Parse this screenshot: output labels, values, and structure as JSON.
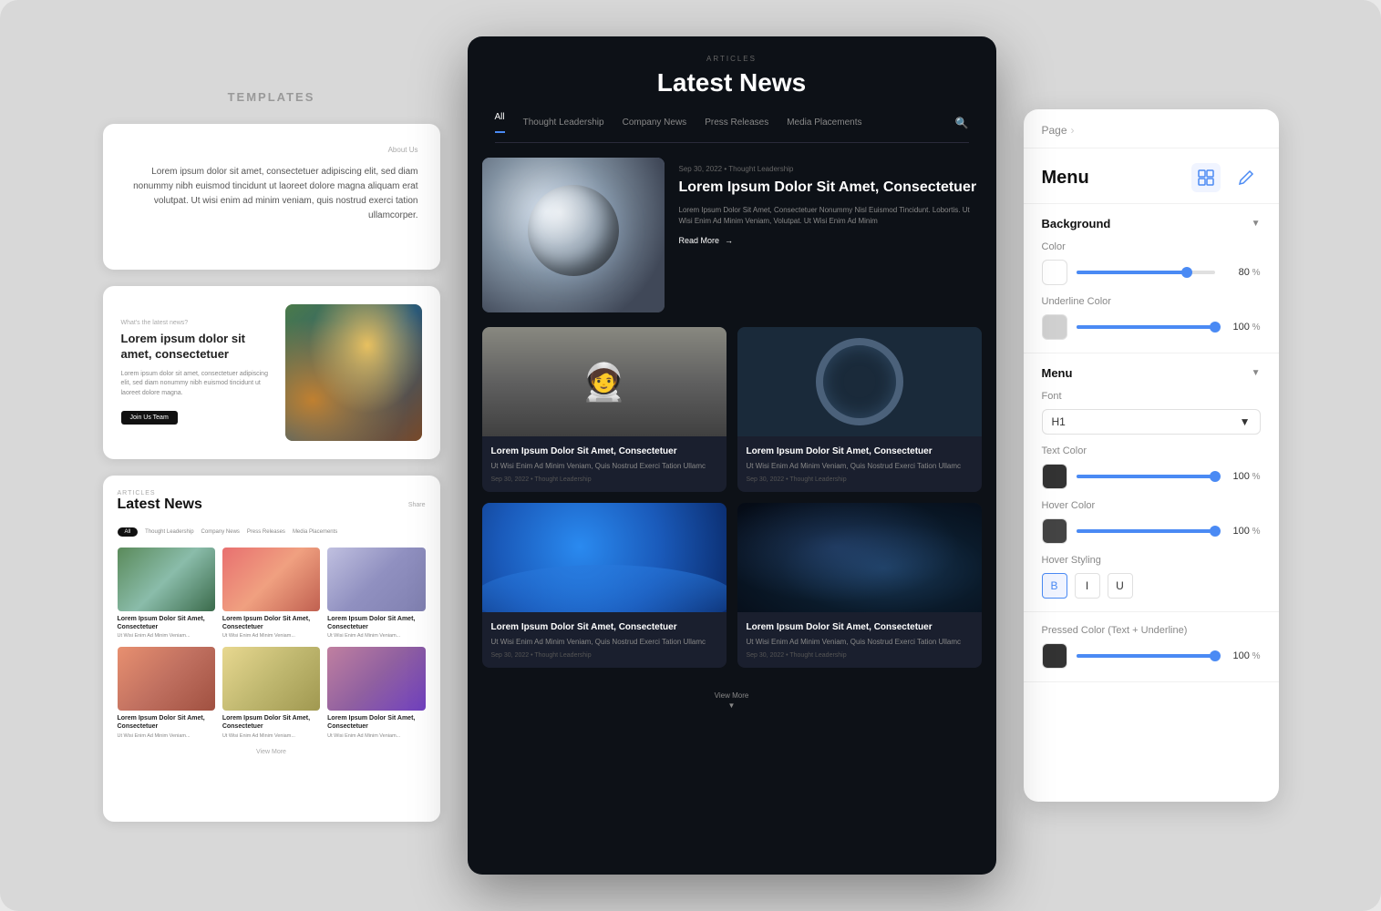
{
  "templates_label": "TEMPLATES",
  "card1": {
    "about_us": "About Us",
    "body": "Lorem ipsum dolor sit amet, consectetuer adipiscing elit, sed diam nonummy nibh euismod tincidunt ut laoreet dolore magna aliquam erat volutpat. Ut wisi enim ad minim veniam, quis nostrud exerci tation ullamcorper."
  },
  "card2": {
    "label": "What's the latest news?",
    "heading": "Lorem ipsum dolor sit amet, consectetuer",
    "body": "Lorem ipsum dolor sit amet, consectetuer adipiscing elit, sed diam nonummy nibh euismod tincidunt ut laoreet dolore magna.",
    "btn_label": "Join Us Team"
  },
  "card3": {
    "articles_label": "ARTICLES",
    "title": "Latest News",
    "share": "Share",
    "nav_items": [
      "All",
      "Thought Leadership",
      "Company News",
      "Press Releases",
      "Media Placements"
    ],
    "items": [
      {
        "title": "Lorem Ipsum Dolor Sit Amet, Consectetuer",
        "body": "Ut Wisi Enim Ad Minim Veniam, Quis Nostrud Exerci Tation Ullamc"
      },
      {
        "title": "Lorem Ipsum Dolor Sit Amet, Consectetuer",
        "body": "Ut Wisi Enim Ad Minim Veniam, Quis Nostrud Exerci Tation Ullamc"
      },
      {
        "title": "Lorem Ipsum Dolor Sit Amet, Consectetuer",
        "body": "Ut Wisi Enim Ad Minim Veniam, Quis Nostrud Exerci Tation Ullamc"
      },
      {
        "title": "Lorem Ipsum Dolor Sit Amet, Consectetuer",
        "body": "Ut Wisi Enim Ad Minim Veniam, Quis Nostrud Exerci Tation Ullamc"
      },
      {
        "title": "Lorem Ipsum Dolor Sit Amet, Consectetuer",
        "body": "Ut Wisi Enim Ad Minim Veniam, Quis Nostrud Exerci Tation Ullamc"
      },
      {
        "title": "Lorem Ipsum Dolor Sit Amet, Consectetuer",
        "body": "Ut Wisi Enim Ad Minim Veniam, Quis Nostrud Exerci Tation Ullamc"
      }
    ],
    "view_more": "View More"
  },
  "preview": {
    "articles_label": "ARTICLES",
    "title": "Latest News",
    "nav_items": [
      "All",
      "Thought Leadership",
      "Company News",
      "Press Releases",
      "Media Placements"
    ],
    "hero": {
      "meta": "Sep 30, 2022  •  Thought Leadership",
      "heading": "Lorem Ipsum Dolor Sit Amet, Consectetuer",
      "body": "Lorem Ipsum Dolor Sit Amet, Consectetuer Nonummy Nisl Euismod Tincidunt. Lobortis. Ut Wisi Enim Ad Minim Veniam, Volutpat. Ut Wisi Enim Ad Minim",
      "read_more": "Read More"
    },
    "articles": [
      {
        "title": "Lorem Ipsum Dolor Sit Amet, Consectetuer",
        "body": "Ut Wisi Enim Ad Minim Veniam, Quis Nostrud Exerci Tation Ullamc",
        "meta": "Sep 30, 2022  •  Thought Leadership"
      },
      {
        "title": "Lorem Ipsum Dolor Sit Amet, Consectetuer",
        "body": "Ut Wisi Enim Ad Minim Veniam, Quis Nostrud Exerci Tation Ullamc",
        "meta": "Sep 30, 2022  •  Thought Leadership"
      },
      {
        "title": "Lorem Ipsum Dolor Sit Amet, Consectetuer",
        "body": "Ut Wisi Enim Ad Minim Veniam, Quis Nostrud Exerci Tation Ullamc",
        "meta": "Sep 30, 2022  •  Thought Leadership"
      },
      {
        "title": "Lorem Ipsum Dolor Sit Amet, Consectetuer",
        "body": "Ut Wisi Enim Ad Minim Veniam, Quis Nostrud Exerci Tation Ullamc",
        "meta": "Sep 30, 2022  •  Thought Leadership"
      }
    ],
    "view_more": "View More"
  },
  "panel": {
    "breadcrumb": "Page",
    "title": "Menu",
    "sections": {
      "background": {
        "label": "Background",
        "color_label": "Color",
        "color_value": "80",
        "underline_color_label": "Underline Color",
        "underline_value": "100"
      },
      "menu": {
        "label": "Menu",
        "font_label": "Font",
        "font_value": "H1",
        "text_color_label": "Text Color",
        "text_value": "100",
        "hover_color_label": "Hover Color",
        "hover_value": "100",
        "hover_styling_label": "Hover Styling",
        "bold_label": "B",
        "italic_label": "I",
        "underline_label": "U",
        "pressed_color_label": "Pressed Color (Text + Underline)",
        "pressed_value": "100"
      }
    }
  }
}
